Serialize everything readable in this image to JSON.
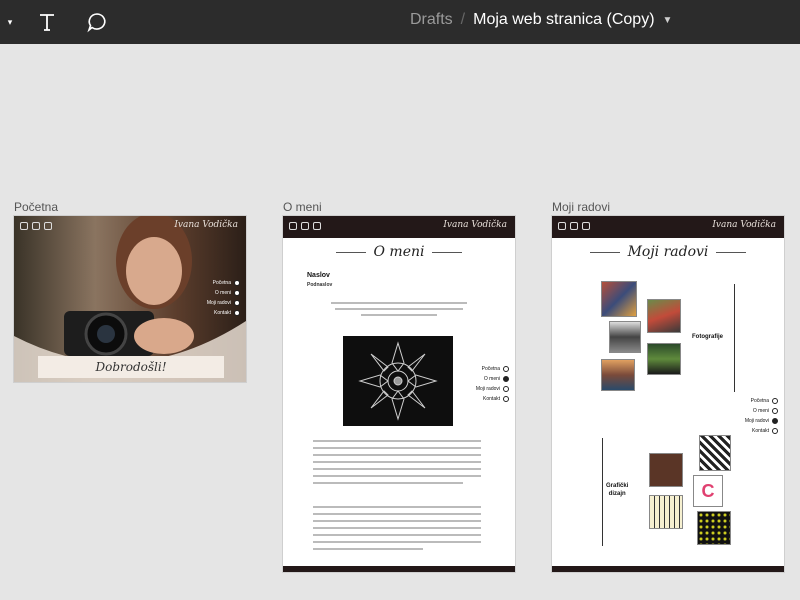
{
  "toolbar": {
    "tools": [
      {
        "name": "shape-tool-dropdown",
        "icon": "chevron-down-icon"
      },
      {
        "name": "text-tool",
        "icon": "text-icon"
      },
      {
        "name": "comment-tool",
        "icon": "comment-icon"
      }
    ],
    "breadcrumb": "Drafts",
    "separator": "/",
    "file_name": "Moja web stranica (Copy)"
  },
  "frames": [
    {
      "label": "Početna",
      "brand": "Ivana Vodička",
      "banner": "Dobrodošli!",
      "nav": [
        "Početna",
        "O meni",
        "Moji radovi",
        "Kontakt"
      ],
      "active": 0
    },
    {
      "label": "O meni",
      "brand": "Ivana Vodička",
      "title": "O meni",
      "heading": "Naslov",
      "subheading": "Podnaslov",
      "nav": [
        "Početna",
        "O meni",
        "Moji radovi",
        "Kontakt"
      ],
      "active": 1
    },
    {
      "label": "Moji radovi",
      "brand": "Ivana Vodička",
      "title": "Moji radovi",
      "section1": "Fotografije",
      "section2a": "Grafički",
      "section2b": "dizajn",
      "nav": [
        "Početna",
        "O meni",
        "Moji radovi",
        "Kontakt"
      ],
      "active": 2
    }
  ],
  "colors": {
    "header_bg": "#2c2c2c",
    "canvas_bg": "#e5e5e5",
    "frame_header": "#231818"
  }
}
